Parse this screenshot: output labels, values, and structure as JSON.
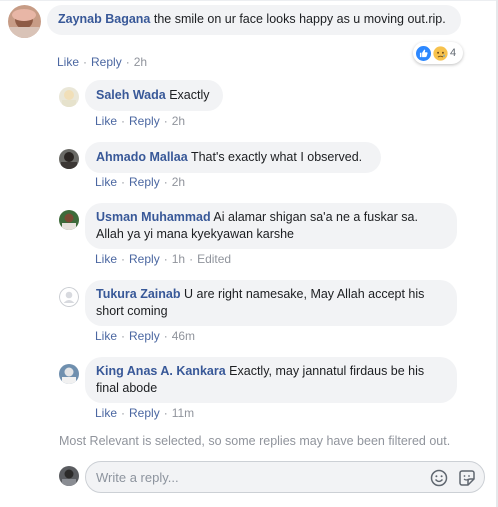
{
  "comment": {
    "author": "Zaynab Bagana",
    "text": "the smile on ur face looks happy as u moving out.rip.",
    "like_label": "Like",
    "reply_label": "Reply",
    "time": "2h",
    "reaction_count": "4",
    "reaction_icons": [
      "like-icon",
      "sad-icon"
    ]
  },
  "replies": [
    {
      "author": "Saleh Wada",
      "text": "Exactly",
      "like_label": "Like",
      "reply_label": "Reply",
      "time": "2h"
    },
    {
      "author": "Ahmado Mallaa",
      "text": "That's exactly what I observed.",
      "like_label": "Like",
      "reply_label": "Reply",
      "time": "2h"
    },
    {
      "author": "Usman Muhammad",
      "text": "Ai alamar shigan sa'a ne a fuskar sa. Allah ya yi mana kyekyawan karshe",
      "like_label": "Like",
      "reply_label": "Reply",
      "time": "1h",
      "edited": "Edited"
    },
    {
      "author": "Tukura Zainab",
      "text": "U are right namesake, May Allah accept his short coming",
      "like_label": "Like",
      "reply_label": "Reply",
      "time": "46m"
    },
    {
      "author": "King Anas A. Kankara",
      "text": "Exactly, may jannatul firdaus be his final abode",
      "like_label": "Like",
      "reply_label": "Reply",
      "time": "11m"
    }
  ],
  "filter_note": "Most Relevant is selected, so some replies may have been filtered out.",
  "reply_box": {
    "placeholder": "Write a reply...",
    "icons": [
      "emoji-icon",
      "sticker-icon"
    ]
  },
  "colors": {
    "author_link": "#385898",
    "action_link": "#4b67a1",
    "bubble_bg": "#f2f3f5",
    "meta_gray": "#90949c"
  }
}
